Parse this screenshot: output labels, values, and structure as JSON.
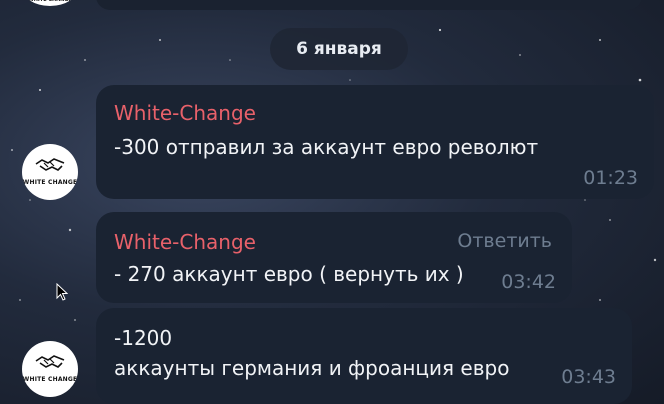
{
  "date_separator": "6 января",
  "messages": [
    {
      "sender": "White-Change",
      "text": "-300 отправил за аккаунт евро револют",
      "time": "01:23"
    },
    {
      "sender": "White-Change",
      "text": "- 270 аккаунт евро ( вернуть их )",
      "time": "03:42",
      "reply_label": "Ответить"
    },
    {
      "text": "-1200\nаккаунты германия и фроанция евро",
      "time": "03:43"
    }
  ],
  "avatar_logo_text": "WHITE CHANGE",
  "colors": {
    "bubble": "#1a2332",
    "sender": "#e8616a",
    "time": "#6e7d90"
  }
}
